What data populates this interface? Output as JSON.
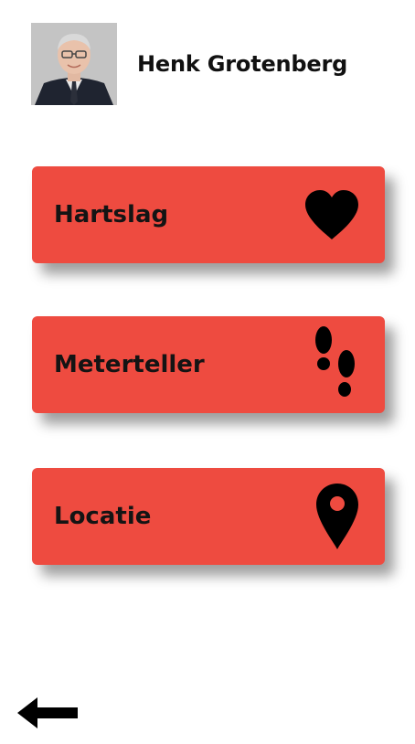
{
  "user": {
    "name": "Henk Grotenberg"
  },
  "menu": {
    "items": [
      {
        "label": "Hartslag",
        "icon": "heart-icon"
      },
      {
        "label": "Meterteller",
        "icon": "footprints-icon"
      },
      {
        "label": "Locatie",
        "icon": "location-pin-icon"
      }
    ],
    "button_color": "#ee4b40"
  },
  "nav": {
    "back_icon": "back-arrow-icon"
  }
}
